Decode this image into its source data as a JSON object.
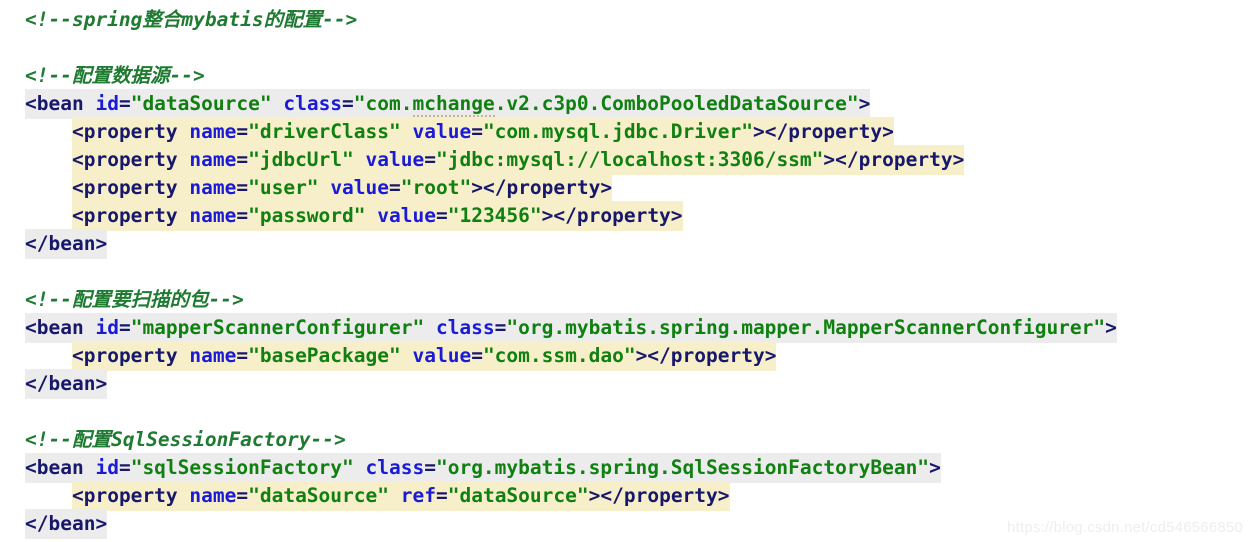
{
  "editor": {
    "background": "#ffffff",
    "highlight_block_color": "#f6efc9",
    "highlight_tag_color": "#ececec",
    "comment_color": "#1f7a32",
    "tag_color": "#17176b",
    "attr_color": "#1b1bd6",
    "string_color": "#108011"
  },
  "watermark": {
    "text": "https://blog.csdn.net/cd546566850"
  },
  "lines": [
    {
      "id": "comment-spring-mybatis",
      "kind": "comment",
      "text": "<!--spring整合mybatis的配置-->"
    },
    {
      "id": "blank-1",
      "kind": "blank",
      "text": ""
    },
    {
      "id": "comment-datasource",
      "kind": "comment",
      "text": "<!--配置数据源-->"
    },
    {
      "id": "bean-datasource-open",
      "kind": "code",
      "indent": "",
      "highlight": "gray",
      "tokens": [
        {
          "t": "punc",
          "v": "<"
        },
        {
          "t": "tag",
          "v": "bean"
        },
        {
          "t": "plain",
          "v": " "
        },
        {
          "t": "attr",
          "v": "id"
        },
        {
          "t": "punc",
          "v": "="
        },
        {
          "t": "str",
          "v": "\"dataSource\""
        },
        {
          "t": "plain",
          "v": " "
        },
        {
          "t": "attr",
          "v": "class"
        },
        {
          "t": "punc",
          "v": "="
        },
        {
          "t": "str",
          "v": "\"com."
        },
        {
          "t": "str-spell",
          "v": "mchange"
        },
        {
          "t": "str",
          "v": ".v2.c3p0.ComboPooledDataSource\""
        },
        {
          "t": "punc",
          "v": ">"
        }
      ]
    },
    {
      "id": "property-driverclass",
      "kind": "code",
      "indent": "    ",
      "highlight": "cream",
      "tokens": [
        {
          "t": "punc",
          "v": "<"
        },
        {
          "t": "tag",
          "v": "property"
        },
        {
          "t": "plain",
          "v": " "
        },
        {
          "t": "attr",
          "v": "name"
        },
        {
          "t": "punc",
          "v": "="
        },
        {
          "t": "str",
          "v": "\"driverClass\""
        },
        {
          "t": "plain",
          "v": " "
        },
        {
          "t": "attr",
          "v": "value"
        },
        {
          "t": "punc",
          "v": "="
        },
        {
          "t": "str",
          "v": "\"com.mysql.jdbc.Driver\""
        },
        {
          "t": "punc",
          "v": "></"
        },
        {
          "t": "tag",
          "v": "property"
        },
        {
          "t": "punc",
          "v": ">"
        }
      ]
    },
    {
      "id": "property-jdbcurl",
      "kind": "code",
      "indent": "    ",
      "highlight": "cream",
      "tokens": [
        {
          "t": "punc",
          "v": "<"
        },
        {
          "t": "tag",
          "v": "property"
        },
        {
          "t": "plain",
          "v": " "
        },
        {
          "t": "attr",
          "v": "name"
        },
        {
          "t": "punc",
          "v": "="
        },
        {
          "t": "str",
          "v": "\"jdbcUrl\""
        },
        {
          "t": "plain",
          "v": " "
        },
        {
          "t": "attr",
          "v": "value"
        },
        {
          "t": "punc",
          "v": "="
        },
        {
          "t": "str",
          "v": "\"jdbc:mysql://localhost:3306/ssm\""
        },
        {
          "t": "punc",
          "v": "></"
        },
        {
          "t": "tag",
          "v": "property"
        },
        {
          "t": "punc",
          "v": ">"
        }
      ]
    },
    {
      "id": "property-user",
      "kind": "code",
      "indent": "    ",
      "highlight": "cream",
      "tokens": [
        {
          "t": "punc",
          "v": "<"
        },
        {
          "t": "tag",
          "v": "property"
        },
        {
          "t": "plain",
          "v": " "
        },
        {
          "t": "attr",
          "v": "name"
        },
        {
          "t": "punc",
          "v": "="
        },
        {
          "t": "str",
          "v": "\"user\""
        },
        {
          "t": "plain",
          "v": " "
        },
        {
          "t": "attr",
          "v": "value"
        },
        {
          "t": "punc",
          "v": "="
        },
        {
          "t": "str",
          "v": "\"root\""
        },
        {
          "t": "punc",
          "v": "></"
        },
        {
          "t": "tag",
          "v": "property"
        },
        {
          "t": "punc",
          "v": ">"
        }
      ]
    },
    {
      "id": "property-password",
      "kind": "code",
      "indent": "    ",
      "highlight": "cream",
      "tokens": [
        {
          "t": "punc",
          "v": "<"
        },
        {
          "t": "tag",
          "v": "property"
        },
        {
          "t": "plain",
          "v": " "
        },
        {
          "t": "attr",
          "v": "name"
        },
        {
          "t": "punc",
          "v": "="
        },
        {
          "t": "str",
          "v": "\"password\""
        },
        {
          "t": "plain",
          "v": " "
        },
        {
          "t": "attr",
          "v": "value"
        },
        {
          "t": "punc",
          "v": "="
        },
        {
          "t": "str",
          "v": "\"123456\""
        },
        {
          "t": "punc",
          "v": "></"
        },
        {
          "t": "tag",
          "v": "property"
        },
        {
          "t": "punc",
          "v": ">"
        }
      ]
    },
    {
      "id": "bean-datasource-close",
      "kind": "code",
      "indent": "",
      "highlight": "gray",
      "tokens": [
        {
          "t": "punc",
          "v": "</"
        },
        {
          "t": "tag",
          "v": "bean"
        },
        {
          "t": "punc",
          "v": ">"
        }
      ]
    },
    {
      "id": "blank-2",
      "kind": "blank",
      "text": ""
    },
    {
      "id": "comment-scan-package",
      "kind": "comment",
      "text": "<!--配置要扫描的包-->"
    },
    {
      "id": "bean-mapperscanner-open",
      "kind": "code",
      "indent": "",
      "highlight": "gray",
      "tokens": [
        {
          "t": "punc",
          "v": "<"
        },
        {
          "t": "tag",
          "v": "bean"
        },
        {
          "t": "plain",
          "v": " "
        },
        {
          "t": "attr",
          "v": "id"
        },
        {
          "t": "punc",
          "v": "="
        },
        {
          "t": "str",
          "v": "\"mapperScannerConfigurer\""
        },
        {
          "t": "plain",
          "v": " "
        },
        {
          "t": "attr",
          "v": "class"
        },
        {
          "t": "punc",
          "v": "="
        },
        {
          "t": "str",
          "v": "\"org.mybatis.spring.mapper.MapperScannerConfigurer\""
        },
        {
          "t": "punc",
          "v": ">"
        }
      ]
    },
    {
      "id": "property-basepackage",
      "kind": "code",
      "indent": "    ",
      "highlight": "cream",
      "tokens": [
        {
          "t": "punc",
          "v": "<"
        },
        {
          "t": "tag",
          "v": "property"
        },
        {
          "t": "plain",
          "v": " "
        },
        {
          "t": "attr",
          "v": "name"
        },
        {
          "t": "punc",
          "v": "="
        },
        {
          "t": "str",
          "v": "\"basePackage\""
        },
        {
          "t": "plain",
          "v": " "
        },
        {
          "t": "attr",
          "v": "value"
        },
        {
          "t": "punc",
          "v": "="
        },
        {
          "t": "str",
          "v": "\"com.ssm.dao\""
        },
        {
          "t": "punc",
          "v": "></"
        },
        {
          "t": "tag",
          "v": "property"
        },
        {
          "t": "punc",
          "v": ">"
        }
      ]
    },
    {
      "id": "bean-mapperscanner-close",
      "kind": "code",
      "indent": "",
      "highlight": "gray",
      "tokens": [
        {
          "t": "punc",
          "v": "</"
        },
        {
          "t": "tag",
          "v": "bean"
        },
        {
          "t": "punc",
          "v": ">"
        }
      ]
    },
    {
      "id": "blank-3",
      "kind": "blank",
      "text": ""
    },
    {
      "id": "comment-sqlsessionfactory",
      "kind": "comment",
      "text": "<!--配置SqlSessionFactory-->"
    },
    {
      "id": "bean-sqlsessionfactory-open",
      "kind": "code",
      "indent": "",
      "highlight": "gray",
      "tokens": [
        {
          "t": "punc",
          "v": "<"
        },
        {
          "t": "tag",
          "v": "bean"
        },
        {
          "t": "plain",
          "v": " "
        },
        {
          "t": "attr",
          "v": "id"
        },
        {
          "t": "punc",
          "v": "="
        },
        {
          "t": "str",
          "v": "\"sqlSessionFactory\""
        },
        {
          "t": "plain",
          "v": " "
        },
        {
          "t": "attr",
          "v": "class"
        },
        {
          "t": "punc",
          "v": "="
        },
        {
          "t": "str",
          "v": "\"org.mybatis.spring.SqlSessionFactoryBean\""
        },
        {
          "t": "punc",
          "v": ">"
        }
      ]
    },
    {
      "id": "property-datasource-ref",
      "kind": "code",
      "indent": "    ",
      "highlight": "cream",
      "tokens": [
        {
          "t": "punc",
          "v": "<"
        },
        {
          "t": "tag",
          "v": "property"
        },
        {
          "t": "plain",
          "v": " "
        },
        {
          "t": "attr",
          "v": "name"
        },
        {
          "t": "punc",
          "v": "="
        },
        {
          "t": "str",
          "v": "\"dataSource\""
        },
        {
          "t": "plain",
          "v": " "
        },
        {
          "t": "attr",
          "v": "ref"
        },
        {
          "t": "punc",
          "v": "="
        },
        {
          "t": "str",
          "v": "\"dataSource\""
        },
        {
          "t": "punc",
          "v": "></"
        },
        {
          "t": "tag",
          "v": "property"
        },
        {
          "t": "punc",
          "v": ">"
        }
      ]
    },
    {
      "id": "bean-sqlsessionfactory-close",
      "kind": "code",
      "indent": "",
      "highlight": "gray",
      "tokens": [
        {
          "t": "punc",
          "v": "</"
        },
        {
          "t": "tag",
          "v": "bean"
        },
        {
          "t": "punc",
          "v": ">"
        }
      ]
    }
  ]
}
